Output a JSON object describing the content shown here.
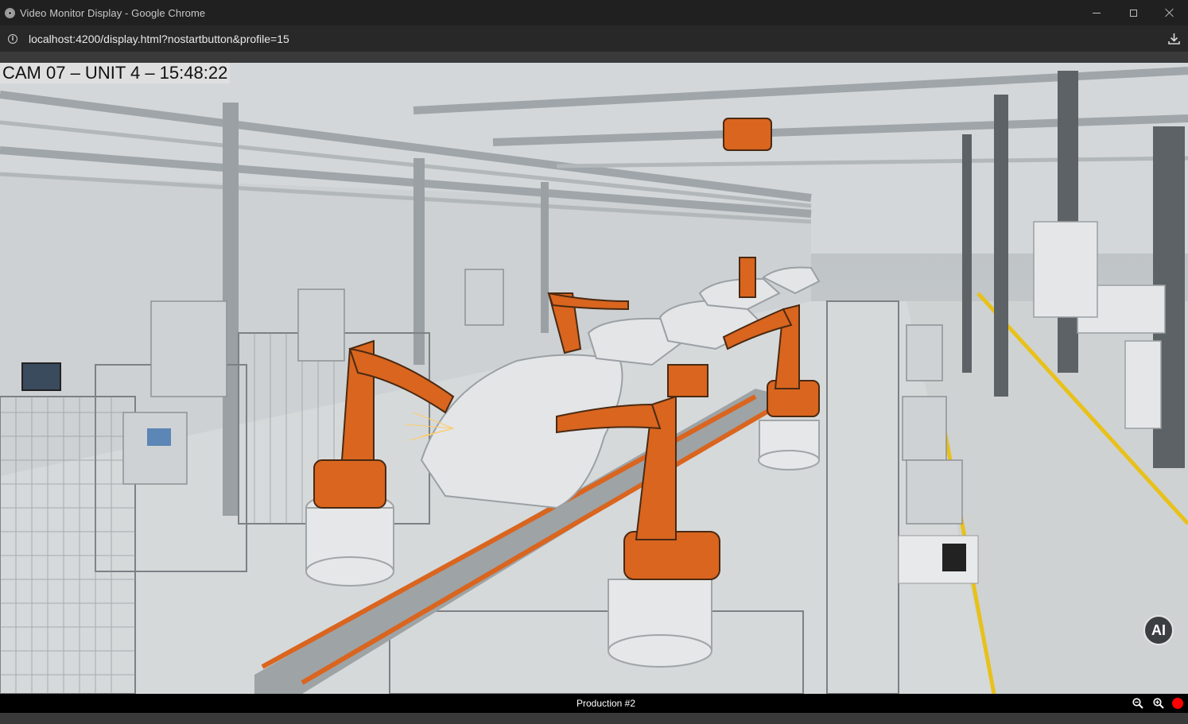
{
  "window": {
    "title": "Video Monitor Display - Google Chrome"
  },
  "address_bar": {
    "url": "localhost:4200/display.html?nostartbutton&profile=15"
  },
  "video": {
    "overlay_text": "CAM 07 – UNIT 4 – 15:48:22",
    "ai_button_label": "AI",
    "scene_colors": {
      "robot_orange": "#d9651f",
      "floor_yellow_line": "#e8c11a",
      "steel_grey": "#a8adb1"
    }
  },
  "bottom_bar": {
    "caption": "Production #2",
    "zoom_out_icon": "zoom-out-icon",
    "zoom_in_icon": "zoom-in-icon",
    "record_color": "#ff0000"
  }
}
